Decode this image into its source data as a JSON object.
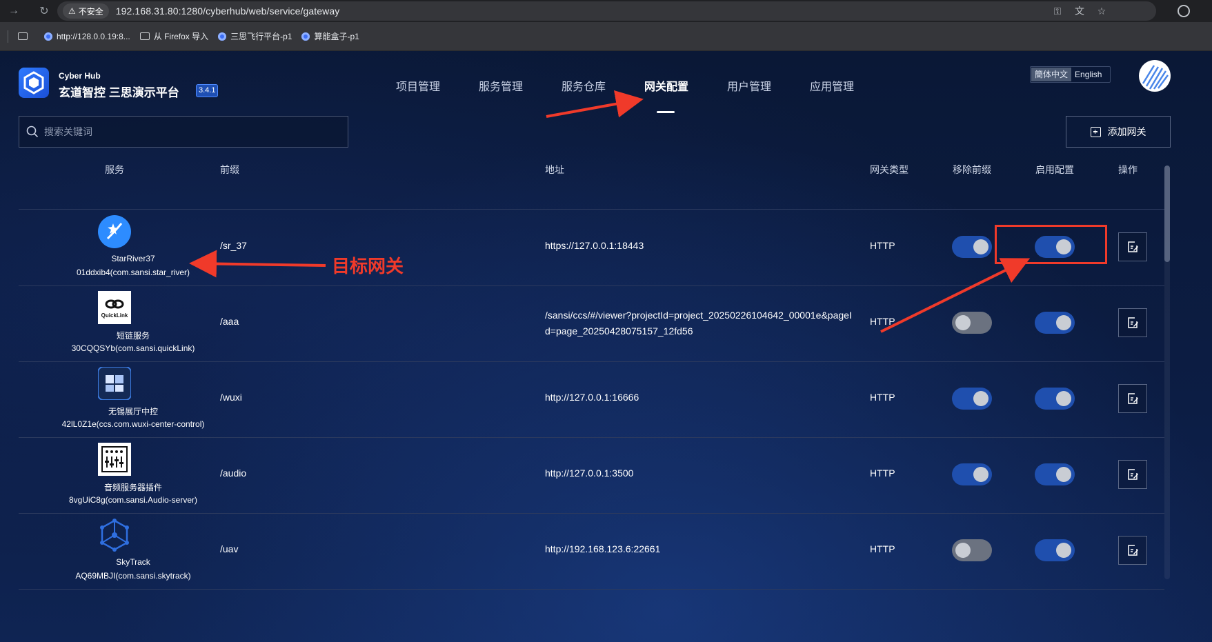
{
  "browser": {
    "insecure_label": "不安全",
    "url": "192.168.31.80:1280/cyberhub/web/service/gateway",
    "bookmarks": [
      {
        "label": "http://128.0.0.19:8..."
      },
      {
        "label": "从 Firefox 导入"
      },
      {
        "label": "三思飞行平台-p1"
      },
      {
        "label": "算能盒子-p1"
      }
    ]
  },
  "app": {
    "brand_top": "Cyber Hub",
    "brand_main": "玄道智控 三思演示平台",
    "version": "3.4.1",
    "nav": [
      {
        "label": "项目管理"
      },
      {
        "label": "服务管理"
      },
      {
        "label": "服务仓库"
      },
      {
        "label": "网关配置"
      },
      {
        "label": "用户管理"
      },
      {
        "label": "应用管理"
      }
    ],
    "active_nav": "网关配置",
    "lang": {
      "zh": "簡体中文",
      "en": "English",
      "selected": "簡体中文"
    },
    "search": {
      "placeholder": "搜索关键词",
      "value": ""
    },
    "add_button": "添加网关",
    "colors": {
      "accent": "#1f4fae",
      "annotation": "#f03a2a"
    }
  },
  "table": {
    "headers": {
      "service": "服务",
      "prefix": "前缀",
      "address": "地址",
      "gateway_type": "网关类型",
      "remove_prefix": "移除前缀",
      "enable_config": "启用配置",
      "actions": "操作"
    },
    "rows": [
      {
        "icon": "star-river-icon",
        "name": "StarRiver37",
        "id": "01ddxib4(com.sansi.star_river)",
        "prefix": "/sr_37",
        "address": "https://127.0.0.1:18443",
        "type": "HTTP",
        "remove_prefix": true,
        "enabled": true
      },
      {
        "icon": "quicklink-icon",
        "name": "短链服务",
        "id": "30CQQSYb(com.sansi.quickLink)",
        "prefix": "/aaa",
        "address": "/sansi/ccs/#/viewer?projectId=project_20250226104642_00001e&pageId=page_20250428075157_12fd56",
        "type": "HTTP",
        "remove_prefix": false,
        "enabled": true
      },
      {
        "icon": "cube-building-icon",
        "name": "无锡展厅中控",
        "id": "42lL0Z1e(ccs.com.wuxi-center-control)",
        "prefix": "/wuxi",
        "address": "http://127.0.0.1:16666",
        "type": "HTTP",
        "remove_prefix": true,
        "enabled": true
      },
      {
        "icon": "audio-mixer-icon",
        "name": "音频服务器插件",
        "id": "8vgUiC8g(com.sansi.Audio-server)",
        "prefix": "/audio",
        "address": "http://127.0.0.1:3500",
        "type": "HTTP",
        "remove_prefix": true,
        "enabled": true
      },
      {
        "icon": "hexagon-network-icon",
        "name": "SkyTrack",
        "id": "AQ69MBJI(com.sansi.skytrack)",
        "prefix": "/uav",
        "address": "http://192.168.123.6:22661",
        "type": "HTTP",
        "remove_prefix": false,
        "enabled": true
      }
    ]
  },
  "annotations": {
    "target_label": "目标网关"
  },
  "icons": {
    "quicklink_text": "QuickLink"
  }
}
